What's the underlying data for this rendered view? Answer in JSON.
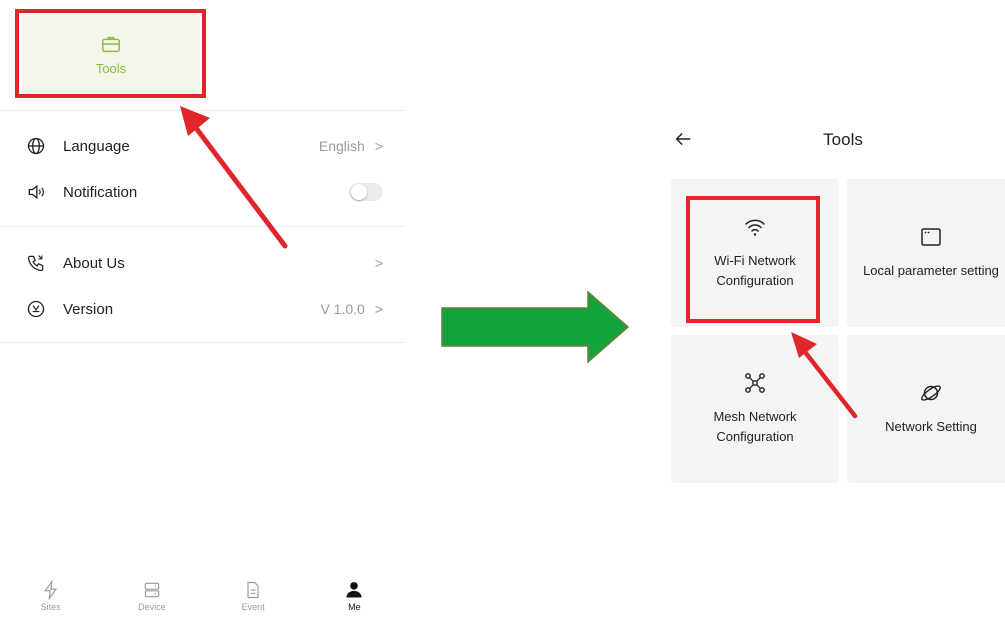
{
  "left_screen": {
    "tools_label": "Tools",
    "settings": [
      {
        "label": "Language",
        "value": "English",
        "icon": "globe-icon"
      },
      {
        "label": "Notification",
        "toggle": false,
        "icon": "speaker-icon"
      },
      {
        "label": "About Us",
        "value": "",
        "icon": "phone-icon"
      },
      {
        "label": "Version",
        "value": "V 1.0.0",
        "icon": "version-icon"
      }
    ],
    "chevron": ">",
    "tabs": [
      {
        "label": "Sites",
        "icon": "bolt-icon",
        "active": false
      },
      {
        "label": "Device",
        "icon": "server-icon",
        "active": false
      },
      {
        "label": "Event",
        "icon": "document-icon",
        "active": false
      },
      {
        "label": "Me",
        "icon": "person-icon",
        "active": true
      }
    ]
  },
  "right_screen": {
    "title": "Tools",
    "tiles": [
      {
        "label_line1": "Wi-Fi Network",
        "label_line2": "Configuration",
        "icon": "wifi-icon"
      },
      {
        "label_line1": "Local parameter setting",
        "label_line2": "",
        "icon": "window-icon"
      },
      {
        "label_line1": "Mesh Network",
        "label_line2": "Configuration",
        "icon": "mesh-icon"
      },
      {
        "label_line1": "Network Setting",
        "label_line2": "",
        "icon": "planet-icon"
      }
    ]
  },
  "colors": {
    "highlight": "#e0262b",
    "accent_green": "#8cbd3a",
    "flow_arrow": "#14a43c"
  }
}
